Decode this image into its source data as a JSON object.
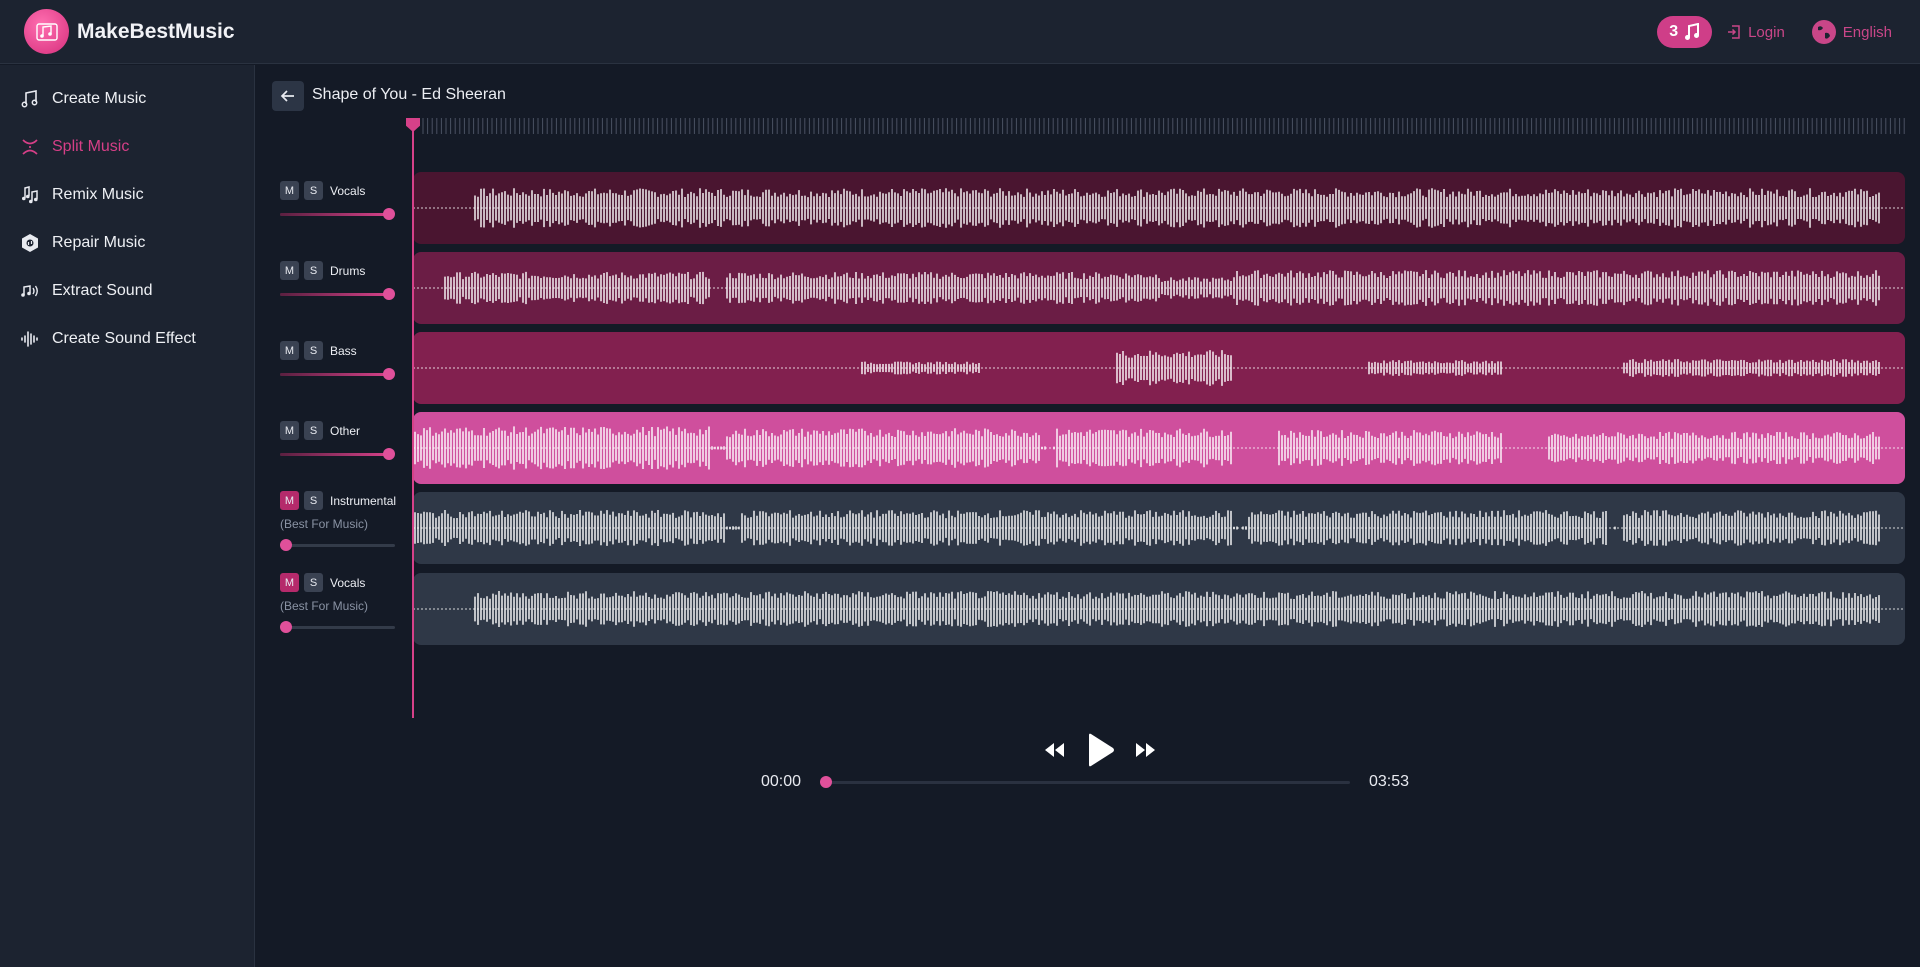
{
  "app": {
    "brand": "MakeBestMusic"
  },
  "header": {
    "credits": "3",
    "login_label": "Login",
    "language_label": "English",
    "accent": "#cf3e88"
  },
  "sidebar": {
    "items": [
      {
        "label": "Create Music",
        "icon": "music-notes-icon",
        "active": false
      },
      {
        "label": "Split Music",
        "icon": "split-icon",
        "active": true
      },
      {
        "label": "Remix Music",
        "icon": "remix-icon",
        "active": false
      },
      {
        "label": "Repair Music",
        "icon": "repair-icon",
        "active": false
      },
      {
        "label": "Extract Sound",
        "icon": "extract-icon",
        "active": false
      },
      {
        "label": "Create Sound Effect",
        "icon": "waveform-icon",
        "active": false
      }
    ]
  },
  "song": {
    "title": "Shape of You - Ed Sheeran"
  },
  "tracks": [
    {
      "name": "Vocals",
      "sub": "",
      "muted": false,
      "volume": 1.0,
      "bg": "#4a1530"
    },
    {
      "name": "Drums",
      "sub": "",
      "muted": false,
      "volume": 1.0,
      "bg": "#6b1d45"
    },
    {
      "name": "Bass",
      "sub": "",
      "muted": false,
      "volume": 1.0,
      "bg": "#82204f"
    },
    {
      "name": "Other",
      "sub": "",
      "muted": false,
      "volume": 1.0,
      "bg": "#cf4f9d"
    },
    {
      "name": "Instrumental",
      "sub": "(Best For Music)",
      "muted": true,
      "volume": 0.0,
      "bg": "#2f3847"
    },
    {
      "name": "Vocals",
      "sub": "(Best For Music)",
      "muted": true,
      "volume": 0.0,
      "bg": "#2f3847"
    }
  ],
  "controls": {
    "mute_label": "M",
    "solo_label": "S"
  },
  "player": {
    "current_time": "00:00",
    "total_time": "03:53",
    "progress": 0.0
  }
}
